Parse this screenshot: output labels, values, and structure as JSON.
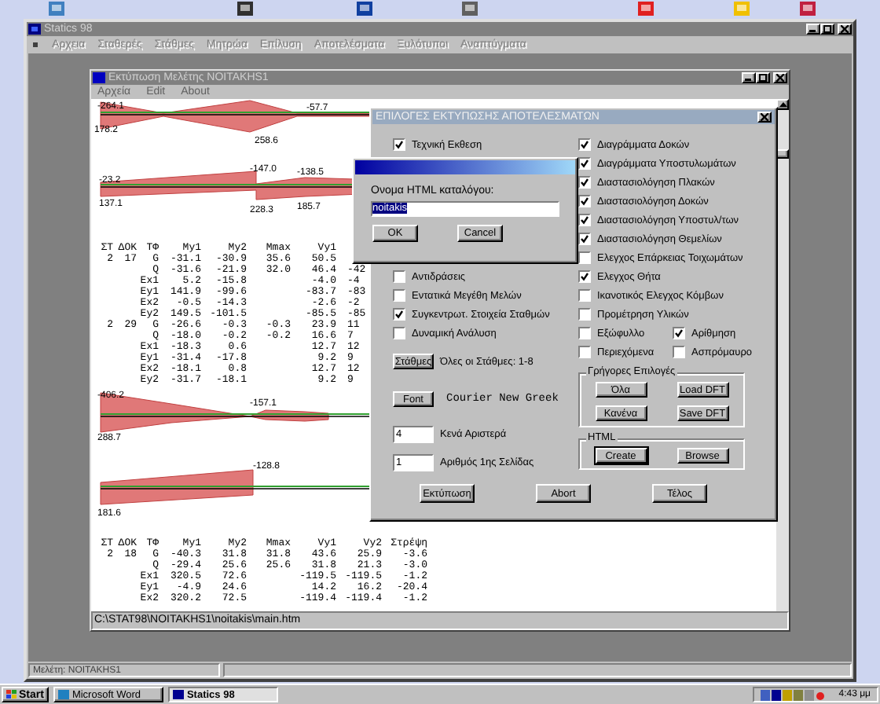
{
  "app": {
    "title": "Statics 98",
    "menu": [
      {
        "label": "Αρχεια",
        "disabled": true
      },
      {
        "label": "Σταθερές",
        "disabled": true
      },
      {
        "label": "Στάθμες",
        "disabled": true
      },
      {
        "label": "Μητρώα",
        "disabled": true
      },
      {
        "label": "Επίλυση",
        "disabled": true
      },
      {
        "label": "Αποτελέσματα",
        "disabled": true
      },
      {
        "label": "Ξυλότυποι",
        "disabled": true
      },
      {
        "label": "Αναπτύγματα",
        "disabled": true
      }
    ],
    "status": "Μελέτη: NOITAKHS1"
  },
  "document_window": {
    "title": "Εκτύπωση Μελέτης NOITAKHS1",
    "menu": [
      "Αρχεία",
      "Edit",
      "About"
    ],
    "content": [
      {
        "kind": "diagram",
        "labels": [
          "-264.1",
          "178.2",
          "258.6",
          "-57.7"
        ]
      },
      {
        "kind": "diagram",
        "labels": [
          "-23.2",
          "137.1",
          "-147.0",
          "228.3",
          "-138.5",
          "185.7"
        ]
      },
      {
        "kind": "table",
        "columns": [
          "ΣΤ",
          "ΔΟΚ",
          "ΤΦ",
          "My1",
          "My2",
          "Mmax",
          "Vy1"
        ],
        "rows": [
          [
            "2",
            "17",
            "G",
            "-31.1",
            "-30.9",
            "35.6",
            "50.5",
            null
          ],
          [
            null,
            null,
            "Q",
            "-31.6",
            "-21.9",
            "32.0",
            "46.4",
            "-42"
          ],
          [
            null,
            null,
            "Ex1",
            "5.2",
            "-15.8",
            null,
            "-4.0",
            "-4"
          ],
          [
            null,
            null,
            "Ey1",
            "141.9",
            "-99.6",
            null,
            "-83.7",
            "-83"
          ],
          [
            null,
            null,
            "Ex2",
            "-0.5",
            "-14.3",
            null,
            "-2.6",
            "-2"
          ],
          [
            null,
            null,
            "Ey2",
            "149.5",
            "-101.5",
            null,
            "-85.5",
            "-85"
          ],
          [
            "2",
            "29",
            "G",
            "-26.6",
            "-0.3",
            "-0.3",
            "23.9",
            "11"
          ],
          [
            null,
            null,
            "Q",
            "-18.0",
            "-0.2",
            "-0.2",
            "16.6",
            "7"
          ],
          [
            null,
            null,
            "Ex1",
            "-18.3",
            "0.6",
            null,
            "12.7",
            "12"
          ],
          [
            null,
            null,
            "Ey1",
            "-31.4",
            "-17.8",
            null,
            "9.2",
            "9"
          ],
          [
            null,
            null,
            "Ex2",
            "-18.1",
            "0.8",
            null,
            "12.7",
            "12"
          ],
          [
            null,
            null,
            "Ey2",
            "-31.7",
            "-18.1",
            null,
            "9.2",
            "9"
          ]
        ]
      },
      {
        "kind": "diagram",
        "labels": [
          "-406.2",
          "288.7",
          "-157.1"
        ]
      },
      {
        "kind": "diagram",
        "labels": [
          "-128.8",
          "181.6"
        ]
      },
      {
        "kind": "table",
        "columns": [
          "ΣΤ",
          "ΔΟΚ",
          "ΤΦ",
          "My1",
          "My2",
          "Mmax",
          "Vy1",
          "Vy2",
          "Στρέψη"
        ],
        "rows": [
          [
            "2",
            "18",
            "G",
            "-40.3",
            "31.8",
            "31.8",
            "43.6",
            "25.9",
            "-3.6"
          ],
          [
            null,
            null,
            "Q",
            "-29.4",
            "25.6",
            "25.6",
            "31.8",
            "21.3",
            "-3.0"
          ],
          [
            null,
            null,
            "Ex1",
            "320.5",
            "72.6",
            null,
            "-119.5",
            "-119.5",
            "-1.2"
          ],
          [
            null,
            null,
            "Ey1",
            "-4.9",
            "24.6",
            null,
            "14.2",
            "16.2",
            "-20.4"
          ],
          [
            null,
            null,
            "Ex2",
            "320.2",
            "72.5",
            null,
            "-119.4",
            "-119.4",
            "-1.2"
          ]
        ]
      }
    ],
    "path": "C:\\STAT98\\NOITAKHS1\\noitakis\\main.htm"
  },
  "print_dialog": {
    "title": "ΕΠΙΛΟΓΕΣ ΕΚΤΥΠΩΣΗΣ ΑΠΟΤΕΛΕΣΜΑΤΩΝ",
    "left_checks": [
      {
        "label": "Τεχνική Εκθεση",
        "checked": true
      },
      {
        "label": "Αντιδράσεις",
        "checked": false
      },
      {
        "label": "Εντατικά Μεγέθη Μελών",
        "checked": false
      },
      {
        "label": "Συγκεντρωτ. Στοιχεία Σταθμών",
        "checked": true
      },
      {
        "label": "Δυναμική Ανάλυση",
        "checked": false
      }
    ],
    "levels_button": "Στάθμες",
    "levels_text": "Όλες οι Στάθμες: 1-8",
    "font_button": "Font",
    "font_name": "Courier New Greek",
    "left_margin": {
      "value": "4",
      "label": "Κενά Αριστερά"
    },
    "first_page": {
      "value": "1",
      "label": "Αριθμός 1ης Σελίδας"
    },
    "right_checks": [
      {
        "label": "Διαγράμματα Δοκών",
        "checked": true
      },
      {
        "label": "Διαγράμματα Υποστυλωμάτων",
        "checked": true
      },
      {
        "label": "Διαστασιολόγηση Πλακών",
        "checked": true
      },
      {
        "label": "Διαστασιολόγηση Δοκών",
        "checked": true
      },
      {
        "label": "Διαστασιολόγηση Υποστυλ/των",
        "checked": true
      },
      {
        "label": "Διαστασιολόγηση Θεμελίων",
        "checked": true
      },
      {
        "label": "Ελεγχος Επάρκειας Τοιχωμάτων",
        "checked": false
      },
      {
        "label": "Ελεγχος Θήτα",
        "checked": true
      },
      {
        "label": "Ικανοτικός Ελεγχος Κόμβων",
        "checked": false
      },
      {
        "label": "Προμέτρηση Υλικών",
        "checked": false
      }
    ],
    "pair_checks": [
      [
        {
          "label": "Εξώφυλλο",
          "checked": false
        },
        {
          "label": "Αρίθμηση",
          "checked": true
        }
      ],
      [
        {
          "label": "Περιεχόμενα",
          "checked": false
        },
        {
          "label": "Ασπρόμαυρο",
          "checked": false
        }
      ]
    ],
    "quick": {
      "title": "Γρήγορες Επιλογές",
      "buttons": [
        "Όλα",
        "Load DFT",
        "Κανένα",
        "Save DFT"
      ]
    },
    "html": {
      "title": "HTML",
      "buttons": [
        "Create",
        "Browse"
      ]
    },
    "buttons": [
      "Εκτύπωση",
      "Abort",
      "Τέλος"
    ]
  },
  "name_dialog": {
    "prompt": "Ονομα HTML καταλόγου:",
    "value": "noitakis",
    "text_selected": true,
    "buttons": [
      "OK",
      "Cancel"
    ]
  },
  "taskbar": {
    "start": "Start",
    "tasks": [
      {
        "label": "Microsoft Word",
        "selected": false
      },
      {
        "label": "Statics 98",
        "selected": true
      }
    ],
    "clock": "4:43 μμ"
  }
}
